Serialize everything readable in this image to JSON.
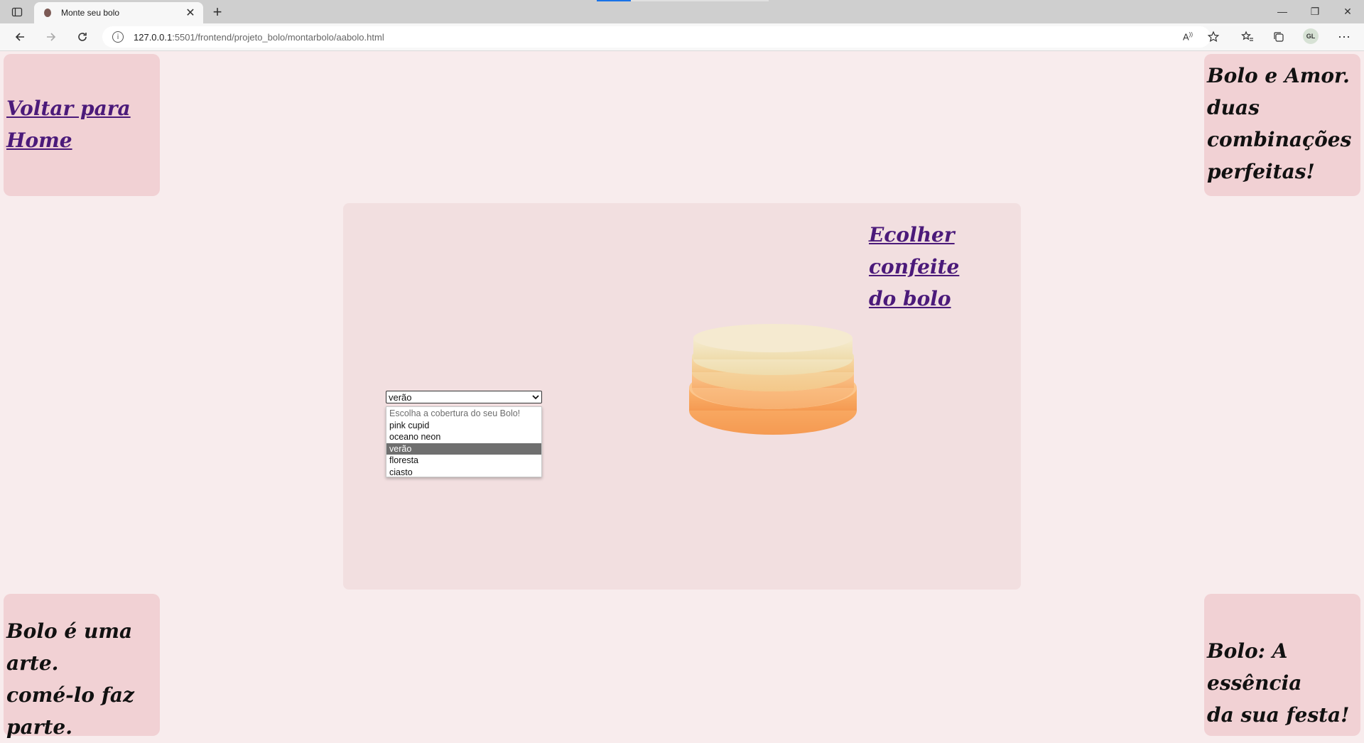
{
  "browser": {
    "tab_title": "Monte seu bolo",
    "tab_close": "✕",
    "new_tab": "+",
    "url_host": "127.0.0.1",
    "url_path": ":5501/frontend/projeto_bolo/montarbolo/aabolo.html",
    "profile_initials": "GL",
    "window_controls": {
      "minimize": "—",
      "restore": "❐",
      "close": "✕"
    }
  },
  "page": {
    "home_link_line1": "Voltar para",
    "home_link_line2": "Home",
    "card_tr_lines": [
      "Bolo e Amor.",
      "duas",
      "combinações",
      "perfeitas!"
    ],
    "card_bl_lines": [
      "Bolo é uma arte.",
      "comé-lo faz",
      "parte."
    ],
    "card_br_lines": [
      "Bolo: A essência",
      "da sua festa!"
    ],
    "confeite_link_line1": "Ecolher confeite",
    "confeite_link_line2": "do bolo",
    "cobertura_select": {
      "selected": "verão",
      "options": [
        {
          "label": "Escolha a cobertura do seu Bolo!",
          "disabled": true
        },
        {
          "label": "pink cupid"
        },
        {
          "label": "oceano neon"
        },
        {
          "label": "verão",
          "selected": true
        },
        {
          "label": "floresta"
        },
        {
          "label": "ciasto"
        }
      ]
    }
  },
  "colors": {
    "page_bg": "#f8eced",
    "card_bg": "#f1d1d4",
    "panel_bg": "#f2dfe0",
    "link": "#4b1a7a",
    "cake_top": "#f3e6c1",
    "cake_bottom": "#f7a865"
  }
}
